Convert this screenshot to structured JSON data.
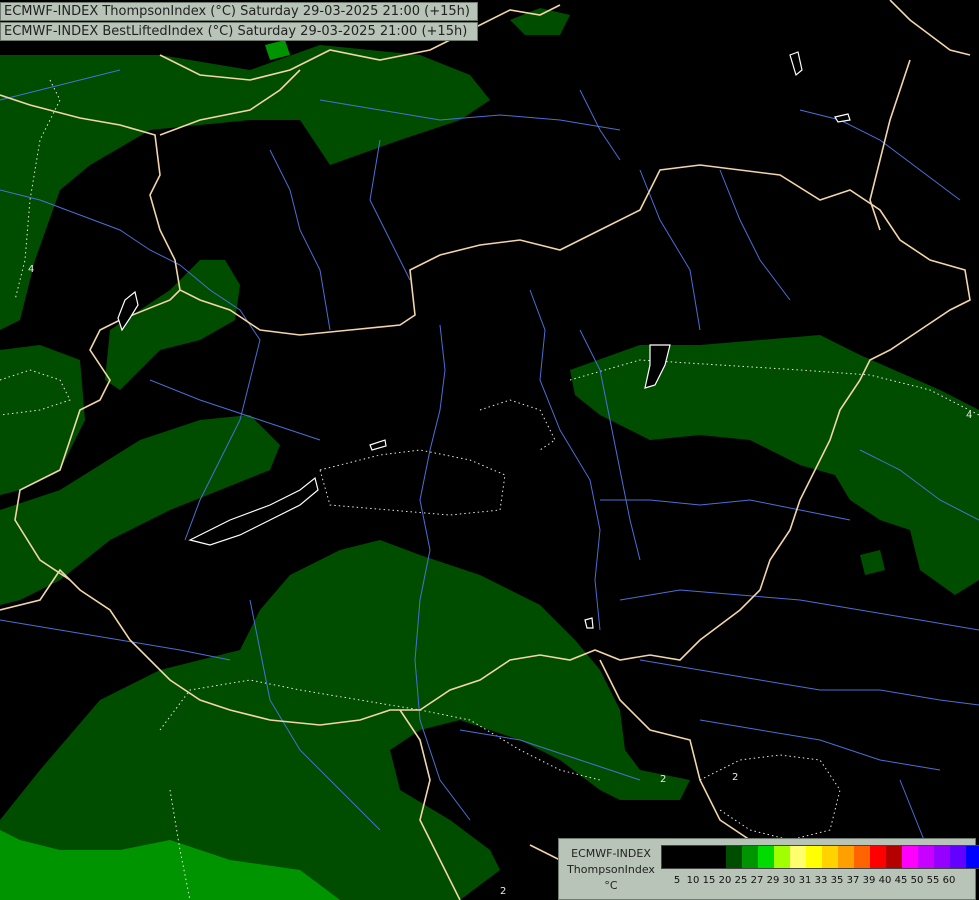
{
  "header": {
    "line1": "ECMWF-INDEX ThompsonIndex (°C) Saturday 29-03-2025 21:00 (+15h)",
    "line2": "ECMWF-INDEX BestLiftedIndex (°C) Saturday 29-03-2025 21:00 (+15h)"
  },
  "legend": {
    "source": "ECMWF-INDEX",
    "parameter": "ThompsonIndex",
    "unit": "°C",
    "ticks": [
      "5",
      "10",
      "15",
      "20",
      "25",
      "27",
      "29",
      "30",
      "31",
      "33",
      "35",
      "37",
      "39",
      "40",
      "45",
      "50",
      "55",
      "60"
    ],
    "colors": [
      "#000000",
      "#000000",
      "#000000",
      "#000000",
      "#004d00",
      "#009400",
      "#00dc00",
      "#a0ff00",
      "#ffff6e",
      "#ffff00",
      "#ffd200",
      "#ffa000",
      "#ff6400",
      "#ff0000",
      "#b40000",
      "#ff00ff",
      "#c800ff",
      "#9600ff",
      "#6400ff",
      "#0000ff"
    ]
  },
  "map": {
    "colors": {
      "background": "#000000",
      "index_25_27": "#004d00",
      "index_27_29": "#009400",
      "index_29_30": "#00dc00",
      "borders": "#f2d5a8",
      "rivers": "#4a6fd6",
      "lakes_outline": "#ffffff"
    },
    "contour_labels": [
      "4",
      "4",
      "2",
      "2",
      "2"
    ]
  }
}
